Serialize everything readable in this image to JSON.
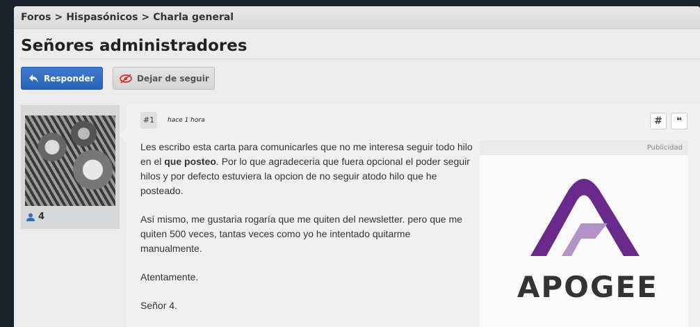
{
  "breadcrumb": {
    "items": [
      "Foros",
      "Hispasónicos",
      "Charla general"
    ],
    "separator": ">"
  },
  "thread": {
    "title": "Señores administradores"
  },
  "actions": {
    "reply_label": "Responder",
    "unfollow_label": "Dejar de seguir"
  },
  "user": {
    "count": "4",
    "count_icon": "user-icon"
  },
  "post": {
    "number": "#1",
    "time": "hace 1 hora",
    "permalink_glyph": "#",
    "quote_glyph": "❝",
    "p1_a": "Les escribo esta carta para comunicarles que no me interesa seguir todo hilo en el ",
    "p1_bold": "que posteo",
    "p1_b": ". Por lo que agradeceria que fuera opcional el poder seguir hilos y por defecto estuviera la opcion de no seguir atodo hilo que he posteado.",
    "p2": "Así mismo, me gustaria rogaría que me quiten del newsletter. pero que me quiten 500 veces, tantas veces como yo he intentado quitarme manualmente.",
    "p3": "Atentamente.",
    "p4": "Señor 4."
  },
  "ad": {
    "label": "Publicidad",
    "brand": "APOGEE",
    "brand_color": "#6a2a8c"
  },
  "colors": {
    "primary_button": "#2f6cc2",
    "background": "#1b2128"
  }
}
